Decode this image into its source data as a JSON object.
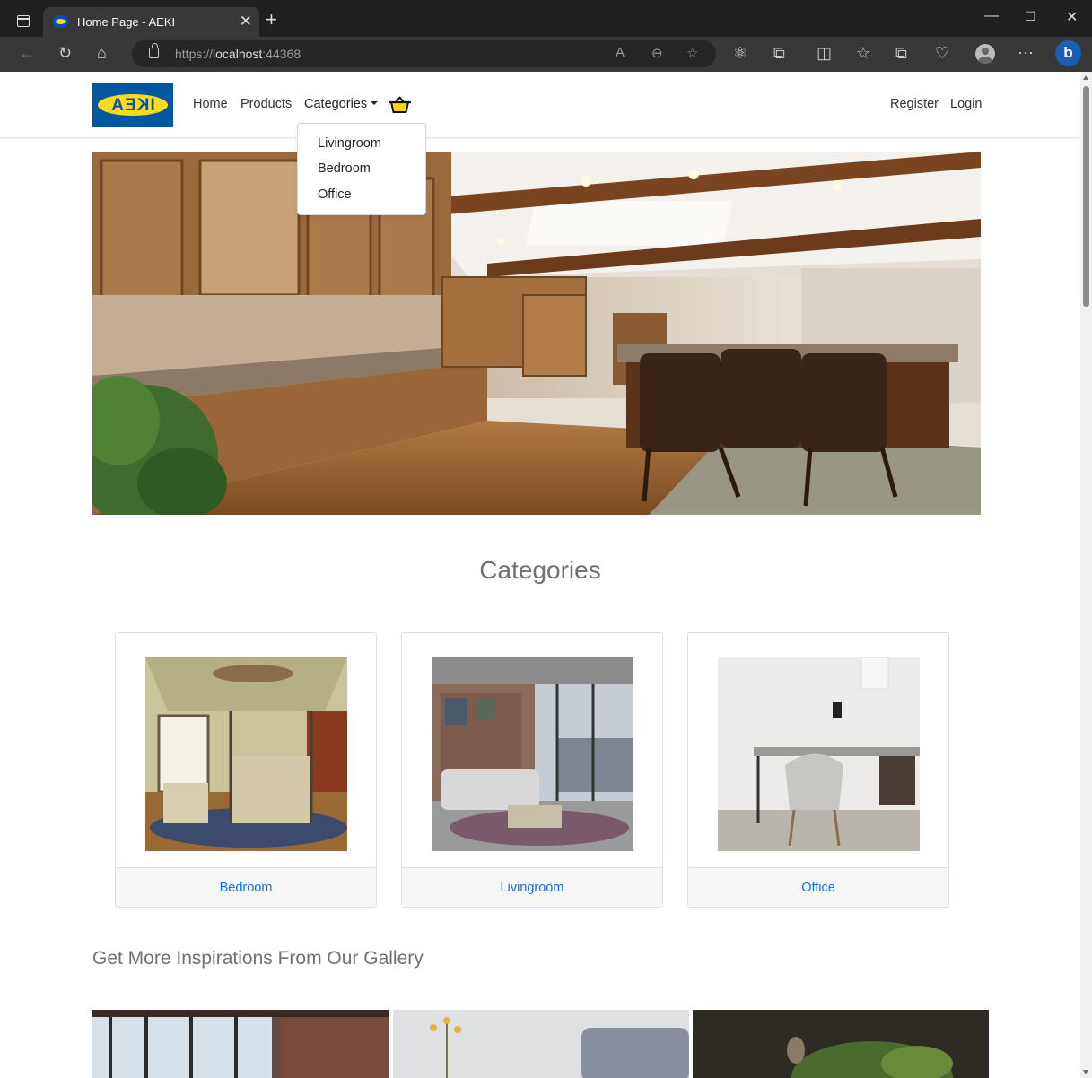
{
  "browser": {
    "tab_title": "Home Page - AEKI",
    "url_scheme": "https://",
    "url_host": "localhost",
    "url_port": ":44368",
    "new_tab_icon": "plus-icon",
    "controls": [
      "minimize-icon",
      "maximize-icon",
      "close-icon"
    ]
  },
  "site": {
    "logo_text": "IKEA",
    "logo_colors": {
      "blue": "#0058a3",
      "yellow": "#ffda1a"
    }
  },
  "nav": {
    "home": "Home",
    "products": "Products",
    "categories": "Categories",
    "register": "Register",
    "login": "Login"
  },
  "dropdown": {
    "items": [
      "Livingroom",
      "Bedroom",
      "Office"
    ]
  },
  "main": {
    "categories_title": "Categories",
    "cards": [
      {
        "label": "Bedroom",
        "image": "bedroom-photo"
      },
      {
        "label": "Livingroom",
        "image": "livingroom-photo"
      },
      {
        "label": "Office",
        "image": "office-photo"
      }
    ],
    "gallery_title": "Get More Inspirations From Our Gallery"
  },
  "colors": {
    "link": "#0d6efd",
    "heading": "#707070"
  }
}
